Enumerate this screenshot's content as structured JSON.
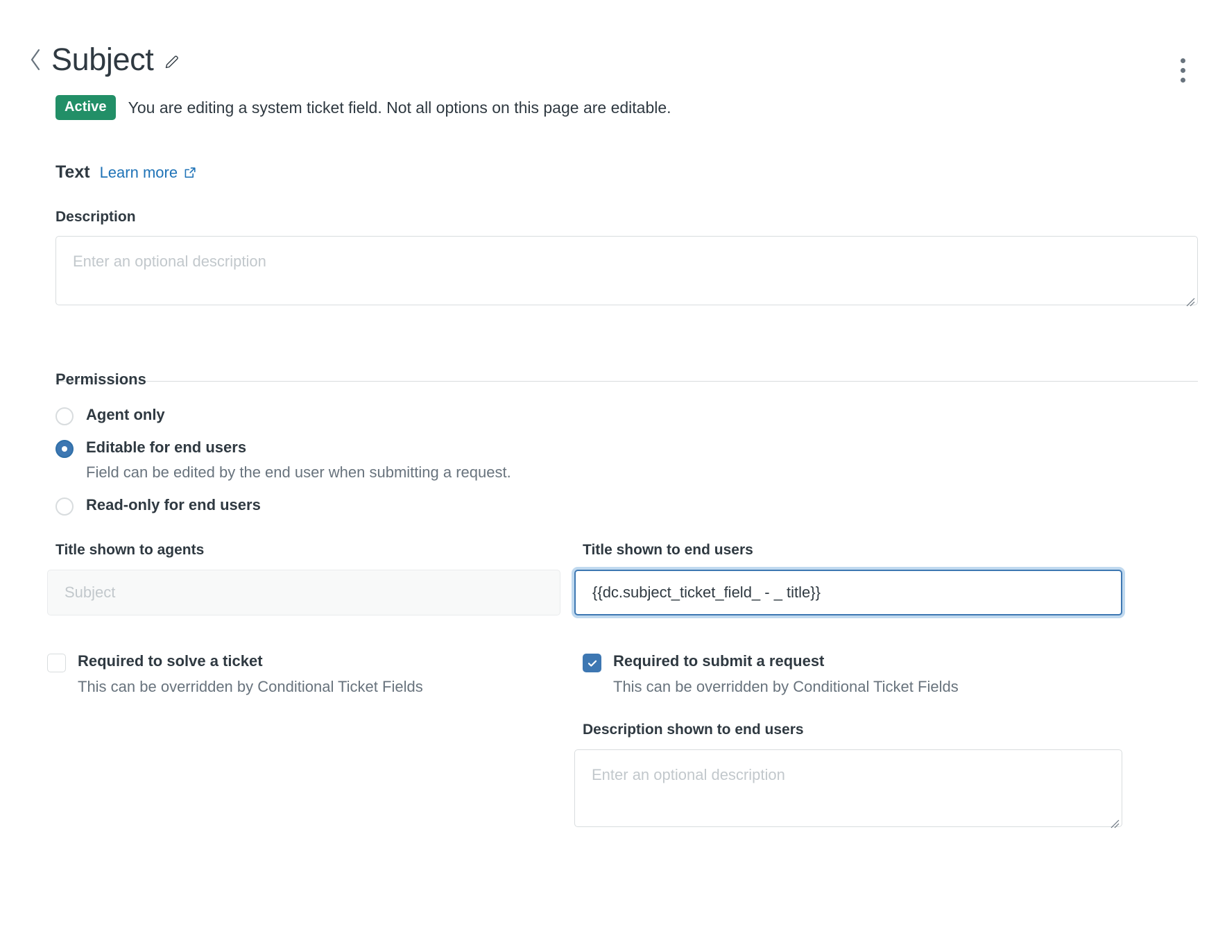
{
  "header": {
    "back_label": "Back",
    "title": "Subject",
    "edit_icon": "pencil-icon",
    "overflow_menu": "more-options"
  },
  "status": {
    "badge": "Active",
    "message": "You are editing a system ticket field. Not all options on this page are editable."
  },
  "field_type": {
    "label": "Text",
    "learn_more": "Learn more",
    "learn_more_icon": "external-link-icon"
  },
  "description": {
    "label": "Description",
    "placeholder": "Enter an optional description",
    "value": ""
  },
  "permissions": {
    "heading": "Permissions",
    "options": [
      {
        "label": "Agent only",
        "help": "",
        "selected": false
      },
      {
        "label": "Editable for end users",
        "help": "Field can be edited by the end user when submitting a request.",
        "selected": true
      },
      {
        "label": "Read-only for end users",
        "help": "",
        "selected": false
      }
    ]
  },
  "agent_title": {
    "label": "Title shown to agents",
    "placeholder": "Subject",
    "value": "",
    "disabled": true
  },
  "end_user_title": {
    "label": "Title shown to end users",
    "value": "{{dc.subject_ticket_field_ - _ title}}",
    "placeholder": "",
    "focused": true
  },
  "required_solve": {
    "label": "Required to solve a ticket",
    "help": "This can be overridden by Conditional Ticket Fields",
    "checked": false
  },
  "required_submit": {
    "label": "Required to submit a request",
    "help": "This can be overridden by Conditional Ticket Fields",
    "checked": true
  },
  "end_user_description": {
    "label": "Description shown to end users",
    "placeholder": "Enter an optional description",
    "value": ""
  },
  "colors": {
    "accent_blue": "#1f73b7",
    "active_green": "#228f67",
    "control_blue": "#3d77b2",
    "text": "#2f3941",
    "muted_text": "#68737d",
    "border": "#d8dcde",
    "placeholder": "#c2c8cc"
  }
}
